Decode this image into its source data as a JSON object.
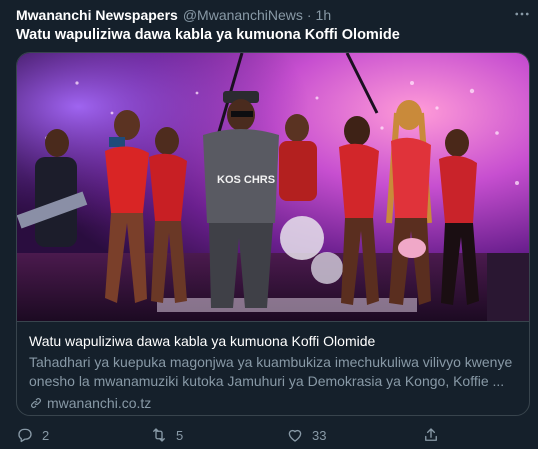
{
  "author": {
    "name": "Mwananchi Newspapers",
    "handle": "@MwananchiNews",
    "separator": "·",
    "time": "1h"
  },
  "tweet": {
    "text": "Watu wapuliziwa dawa kabla ya kumuona Koffi Olomide"
  },
  "card": {
    "title": "Watu wapuliziwa dawa kabla ya kumuona Koffi Olomide",
    "description_line1": "Tahadhari ya kuepuka magonjwa ya kuambukiza imechukuliwa vilivyo kwenye",
    "description_line2": "onesho la mwanamuziki kutoka Jamuhuri ya Demokrasia ya Kongo, Koffie ...",
    "domain": "mwananchi.co.tz",
    "image_text": "KOS CHRS"
  },
  "actions": {
    "reply_count": "2",
    "retweet_count": "5",
    "like_count": "33"
  },
  "colors": {
    "background": "#15202b",
    "border": "#38444d",
    "secondary_text": "#8899a6",
    "primary_text": "#ffffff"
  },
  "icons": [
    "more-icon",
    "link-icon",
    "reply-icon",
    "retweet-icon",
    "like-icon",
    "share-icon"
  ]
}
